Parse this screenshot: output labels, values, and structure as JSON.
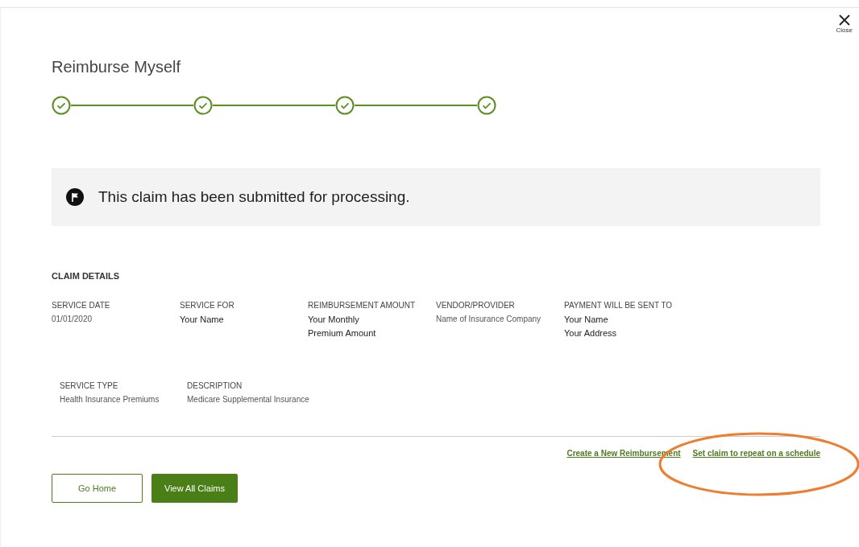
{
  "close": {
    "label": "Close"
  },
  "title": "Reimburse Myself",
  "steps": [
    {
      "completed": true
    },
    {
      "completed": true
    },
    {
      "completed": true
    },
    {
      "completed": true
    }
  ],
  "banner": {
    "message": "This claim has been submitted for processing."
  },
  "claim_details": {
    "heading": "CLAIM DETAILS",
    "rows": [
      [
        {
          "label": "SERVICE DATE",
          "lines": [
            "01/01/2020"
          ],
          "kind": "plain"
        },
        {
          "label": "SERVICE FOR",
          "lines": [
            "Your Name"
          ],
          "kind": "strong"
        },
        {
          "label": "REIMBURSEMENT AMOUNT",
          "lines": [
            "Your Monthly",
            "Premium Amount"
          ],
          "kind": "strong"
        },
        {
          "label": "VENDOR/PROVIDER",
          "lines": [
            "Name of Insurance Company"
          ],
          "kind": "plain"
        },
        {
          "label": "PAYMENT WILL BE SENT TO",
          "lines": [
            "Your Name",
            "Your Address"
          ],
          "kind": "strong"
        }
      ],
      [
        {
          "label": "SERVICE TYPE",
          "lines": [
            "Health Insurance Premiums"
          ],
          "kind": "plain"
        },
        {
          "label": "DESCRIPTION",
          "lines": [
            "Medicare Supplemental Insurance"
          ],
          "kind": "plain"
        }
      ]
    ]
  },
  "links": [
    "Create a New Reimbursement",
    "Set claim to repeat on a schedule"
  ],
  "buttons": [
    {
      "label": "Go Home",
      "kind": "secondary"
    },
    {
      "label": "View All Claims",
      "kind": "primary"
    }
  ]
}
